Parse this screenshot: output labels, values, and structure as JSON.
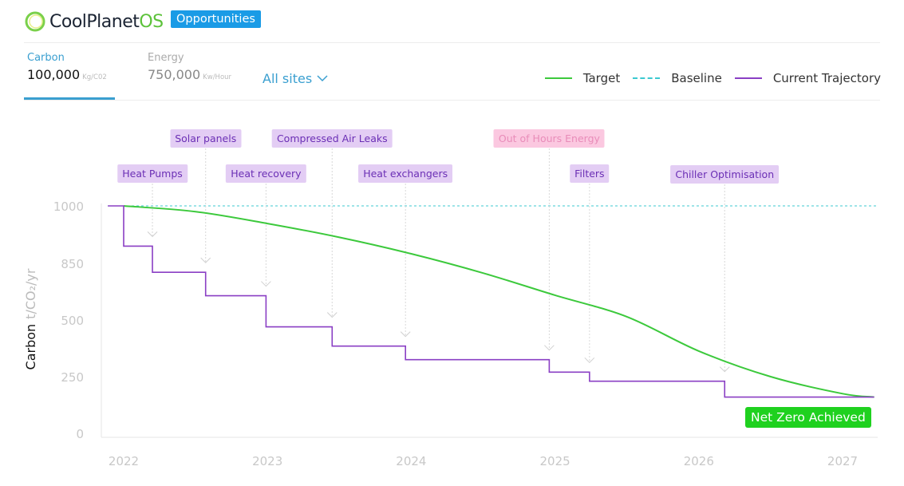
{
  "header": {
    "logo_main": "CoolPlanet",
    "logo_suffix": "OS",
    "badge": "Opportunities"
  },
  "tabs": [
    {
      "label": "Carbon",
      "value": "100,000",
      "unit": "Kg/C02",
      "active": true
    },
    {
      "label": "Energy",
      "value": "750,000",
      "unit": "Kw/Hour",
      "active": false
    }
  ],
  "site_filter": {
    "label": "All sites"
  },
  "colors": {
    "target": "#3cc93c",
    "baseline": "#3cc9d0",
    "trajectory": "#8a3fc4",
    "accent": "#3a9fd0",
    "net_zero": "#1fd11f"
  },
  "chart_data": {
    "type": "line",
    "ylabel": "Carbon",
    "ylabel_unit": "t/CO₂/yr",
    "yticks": [
      1000,
      850,
      500,
      250,
      0
    ],
    "xticks": [
      2022,
      2023,
      2024,
      2025,
      2026,
      2027
    ],
    "legend": [
      "Target",
      "Baseline",
      "Current Trajectory"
    ],
    "legend_position": "top-right",
    "baseline": {
      "name": "Baseline",
      "value": 1000
    },
    "target": {
      "name": "Target",
      "x": [
        2022,
        2022.5,
        2023,
        2023.5,
        2024,
        2024.5,
        2025,
        2025.5,
        2026,
        2026.5,
        2027,
        2027.22
      ],
      "y": [
        1000,
        985,
        954,
        918,
        875,
        790,
        653,
        520,
        363,
        250,
        175,
        160
      ]
    },
    "trajectory": {
      "name": "Current Trajectory",
      "steps": [
        {
          "x": 2021.89,
          "y": 1000
        },
        {
          "x": 2022.0,
          "y": 895
        },
        {
          "x": 2022.2,
          "y": 795
        },
        {
          "x": 2022.57,
          "y": 650
        },
        {
          "x": 2022.99,
          "y": 470
        },
        {
          "x": 2023.45,
          "y": 385
        },
        {
          "x": 2023.96,
          "y": 325
        },
        {
          "x": 2024.96,
          "y": 270
        },
        {
          "x": 2025.24,
          "y": 230
        },
        {
          "x": 2026.18,
          "y": 160
        },
        {
          "x": 2027.22,
          "y": 160
        }
      ]
    },
    "annotations": [
      {
        "label": "Heat Pumps",
        "x": 2022.2
      },
      {
        "label": "Solar panels",
        "x": 2022.57
      },
      {
        "label": "Heat recovery",
        "x": 2022.99
      },
      {
        "label": "Compressed Air Leaks",
        "x": 2023.45
      },
      {
        "label": "Heat exchangers",
        "x": 2023.96
      },
      {
        "label": "Out of Hours Energy",
        "x": 2024.96,
        "style": "muted"
      },
      {
        "label": "Filters",
        "x": 2025.24
      },
      {
        "label": "Chiller Optimisation",
        "x": 2026.18
      }
    ],
    "callout": "Net Zero Achieved"
  }
}
